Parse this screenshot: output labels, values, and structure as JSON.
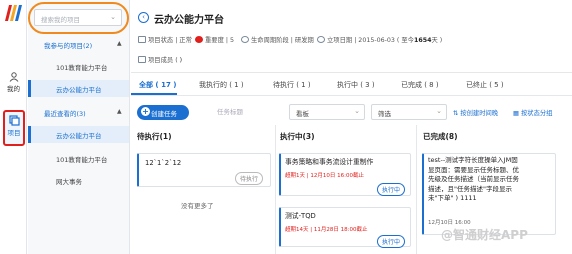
{
  "rail": {
    "my_label": "我的",
    "projects_label": "项目"
  },
  "sidebar": {
    "search_placeholder": "搜索我的项目",
    "joined_header": "我参与的项目(2)",
    "joined": [
      "101教育能力平台",
      "云办公能力平台"
    ],
    "recent_header": "最近查看的(3)",
    "recent": [
      "云办公能力平台",
      "101教育能力平台",
      "网大事务"
    ]
  },
  "header": {
    "title": "云办公能力平台",
    "status": "项目状态 | 正常",
    "importance": "重要度 | 5",
    "lifecycle": "生命周期阶段 | 研发期",
    "start_prefix": "立项日期 | 2015-06-03 ( 至今",
    "start_days": "1654",
    "start_suffix": "天 )",
    "members_label": "项目成员 ("
  },
  "tabs": [
    {
      "label": "全部 ( 17 )"
    },
    {
      "label": "我执行的 ( 1 )"
    },
    {
      "label": "待执行 ( 1 )"
    },
    {
      "label": "执行中 ( 3 )"
    },
    {
      "label": "已完成 ( 8 )"
    },
    {
      "label": "已终止 ( 5 )"
    }
  ],
  "toolbar": {
    "create_label": "创建任务",
    "search_placeholder": "任务标题",
    "filter1": "看板",
    "filter2": "筛选",
    "sort_label": "按创建时间晚",
    "group_label": "按状态分组"
  },
  "columns": {
    "todo": {
      "title": "待执行(1)",
      "cards": [
        {
          "title": "12`1`2`12",
          "badge": "待执行"
        }
      ],
      "empty": "没有更多了"
    },
    "doing": {
      "title": "执行中(3)",
      "cards": [
        {
          "title": "事务策略和事务流设计重制作",
          "meta": "超期1天 | 12月10日 16:00截止",
          "badge": "执行中"
        },
        {
          "title": "测试-TQD",
          "meta": "超期14天 | 11月28日 18:00截止",
          "badge": "执行中"
        }
      ]
    },
    "done": {
      "title": "已完成(8)",
      "cards": [
        {
          "lines": [
            "test--测试字符长度操单入JM固",
            "显页面：需要显示任务标题、优",
            "先级及任务描述（当前显示任务",
            "描述，且\"任务描述\"字段显示",
            "未\"下单\" ) 1111"
          ],
          "meta": "12月10日 16:00"
        }
      ]
    }
  },
  "watermark": "@智通财经APP"
}
